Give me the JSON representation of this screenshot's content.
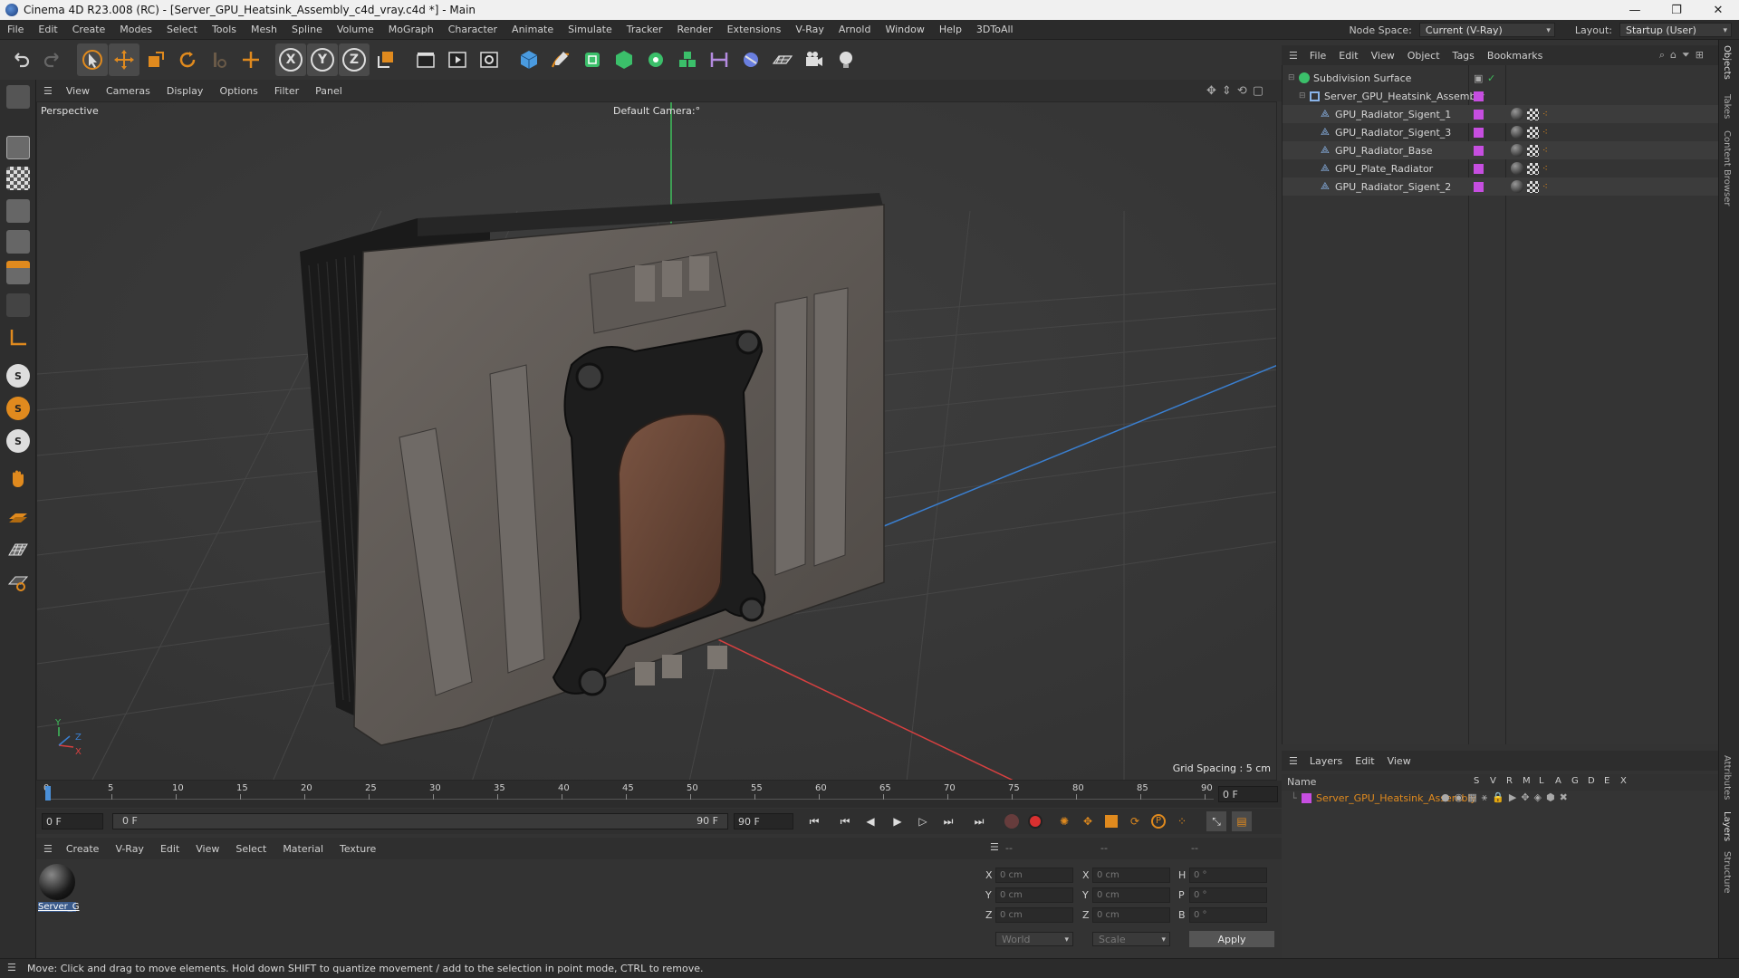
{
  "window": {
    "title": "Cinema 4D R23.008 (RC) - [Server_GPU_Heatsink_Assembly_c4d_vray.c4d *] - Main",
    "controls": [
      "—",
      "❐",
      "✕"
    ]
  },
  "menubar": {
    "items": [
      "File",
      "Edit",
      "Create",
      "Modes",
      "Select",
      "Tools",
      "Mesh",
      "Spline",
      "Volume",
      "MoGraph",
      "Character",
      "Animate",
      "Simulate",
      "Tracker",
      "Render",
      "Extensions",
      "V-Ray",
      "Arnold",
      "Window",
      "Help",
      "3DToAll"
    ],
    "node_space_label": "Node Space:",
    "node_space_value": "Current (V-Ray)",
    "layout_label": "Layout:",
    "layout_value": "Startup (User)"
  },
  "viewport": {
    "menu": [
      "View",
      "Cameras",
      "Display",
      "Options",
      "Filter",
      "Panel"
    ],
    "projection_label": "Perspective",
    "camera_label": "Default Camera",
    "camera_suffix": ":°",
    "grid_spacing": "Grid Spacing : 5 cm",
    "axis_y": "Y",
    "axis_z": "Z",
    "axis_x": "X"
  },
  "timeline": {
    "ticks": [
      "0",
      "5",
      "10",
      "15",
      "20",
      "25",
      "30",
      "35",
      "40",
      "45",
      "50",
      "55",
      "60",
      "65",
      "70",
      "75",
      "80",
      "85",
      "90"
    ],
    "current_frame_field": "0 F",
    "start_field": "0 F",
    "range_start": "0 F",
    "range_end": "90 F",
    "end_field": "90 F"
  },
  "material_panel": {
    "menu": [
      "Create",
      "V-Ray",
      "Edit",
      "View",
      "Select",
      "Material",
      "Texture"
    ],
    "material_name": "Server_G"
  },
  "coordinates": {
    "header": [
      "--",
      "--",
      "--"
    ],
    "rows": [
      {
        "a": "X",
        "av": "0 cm",
        "b": "X",
        "bv": "0 cm",
        "c": "H",
        "cv": "0 °"
      },
      {
        "a": "Y",
        "av": "0 cm",
        "b": "Y",
        "bv": "0 cm",
        "c": "P",
        "cv": "0 °"
      },
      {
        "a": "Z",
        "av": "0 cm",
        "b": "Z",
        "bv": "0 cm",
        "c": "B",
        "cv": "0 °"
      }
    ],
    "space": "World",
    "mode": "Scale",
    "apply": "Apply"
  },
  "status": {
    "text": "Move: Click and drag to move elements. Hold down SHIFT to quantize movement / add to the selection in point mode, CTRL to remove."
  },
  "object_manager": {
    "menu": [
      "File",
      "Edit",
      "View",
      "Object",
      "Tags",
      "Bookmarks"
    ],
    "objects": [
      {
        "name": "Subdivision Surface",
        "level": 0
      },
      {
        "name": "Server_GPU_Heatsink_Assembly",
        "level": 1
      },
      {
        "name": "GPU_Radiator_Sigent_1",
        "level": 2
      },
      {
        "name": "GPU_Radiator_Sigent_3",
        "level": 2
      },
      {
        "name": "GPU_Radiator_Base",
        "level": 2
      },
      {
        "name": "GPU_Plate_Radiator",
        "level": 2
      },
      {
        "name": "GPU_Radiator_Sigent_2",
        "level": 2
      }
    ]
  },
  "layers": {
    "menu": [
      "Layers",
      "Edit",
      "View"
    ],
    "name_header": "Name",
    "columns": [
      "S",
      "V",
      "R",
      "M",
      "L",
      "A",
      "G",
      "D",
      "E",
      "X"
    ],
    "items": [
      {
        "name": "Server_GPU_Heatsink_Assembly"
      }
    ]
  },
  "right_tabs": [
    "Objects",
    "Takes",
    "Content Browser",
    "Attributes",
    "Layers",
    "Structure"
  ],
  "colors": {
    "accent_orange": "#e08a1e",
    "layer_purple": "#c64ee0",
    "axis_green": "#3fbf5c",
    "axis_red": "#d94040",
    "axis_blue": "#3a7fd0"
  }
}
